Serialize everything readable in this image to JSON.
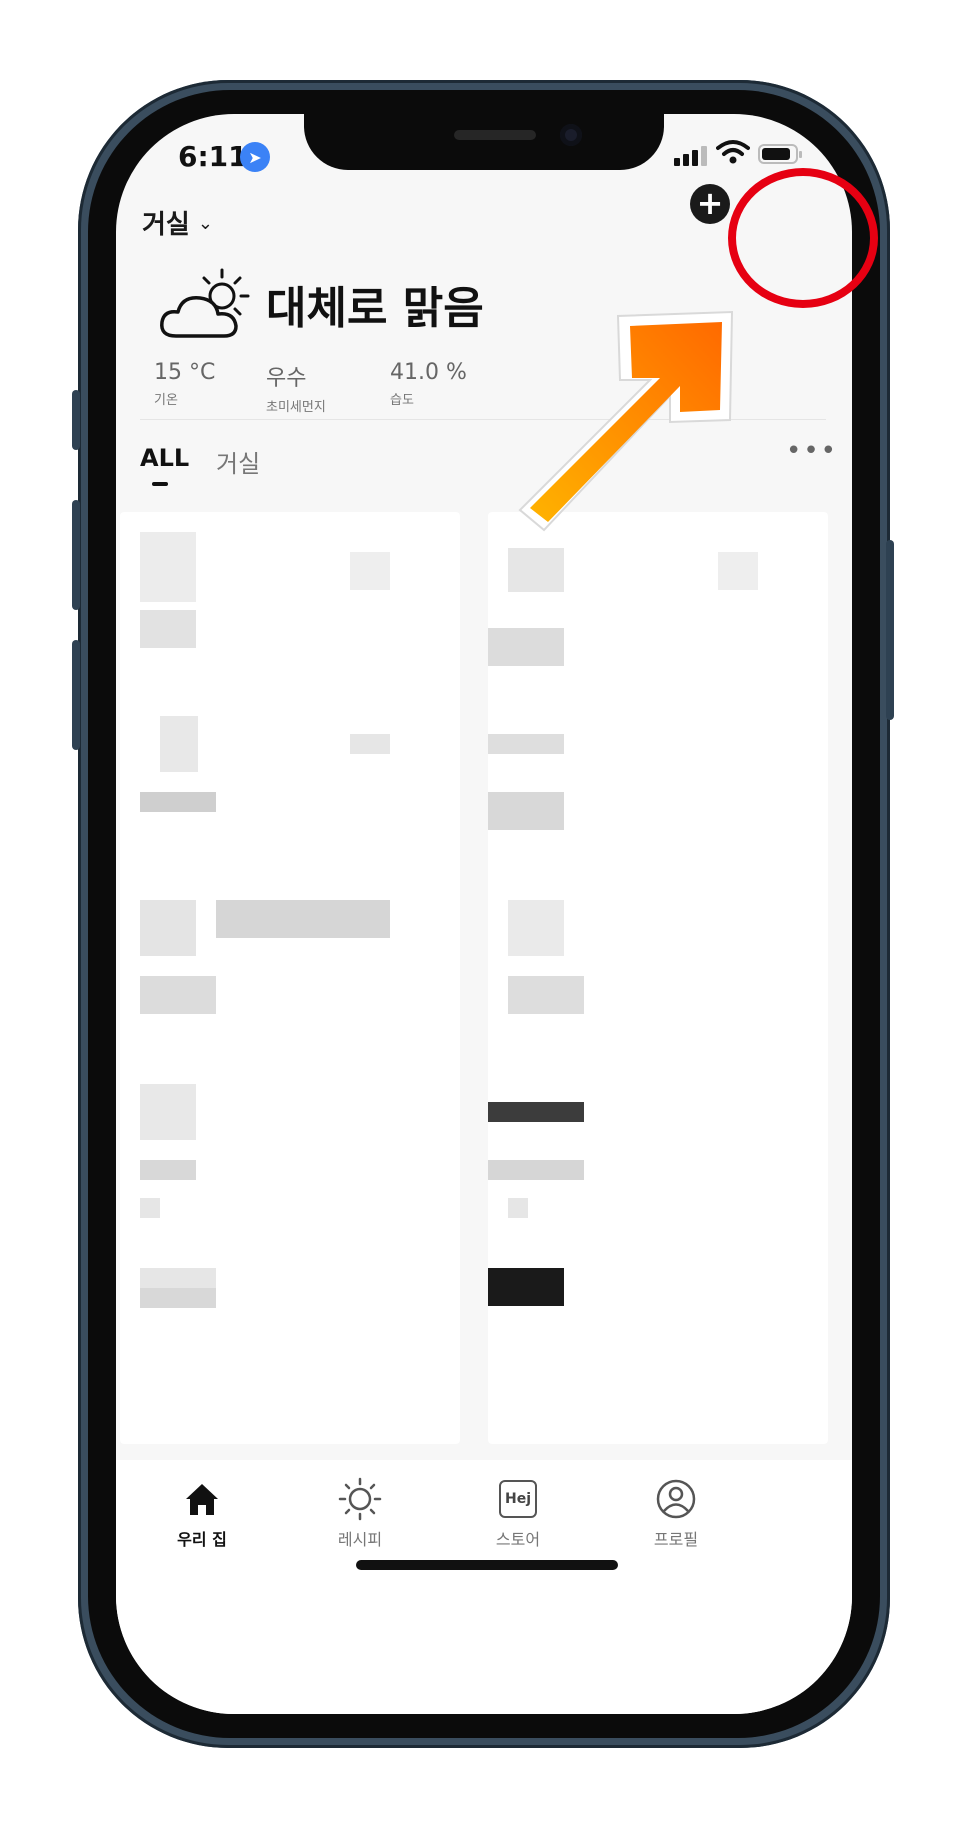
{
  "status_bar": {
    "time": "6:11"
  },
  "header": {
    "room": "거실"
  },
  "weather": {
    "condition": "대체로 맑음",
    "stats": [
      {
        "value": "15 °C",
        "label": "기온"
      },
      {
        "value": "우수",
        "label": "초미세먼지"
      },
      {
        "value": "41.0 %",
        "label": "습도"
      }
    ]
  },
  "tabs": [
    {
      "label": "ALL"
    },
    {
      "label": "거실"
    }
  ],
  "bottom_nav": [
    {
      "label": "우리 집",
      "icon": "home-icon"
    },
    {
      "label": "레시피",
      "icon": "sun-icon"
    },
    {
      "label": "스토어",
      "icon": "hej-store-icon"
    },
    {
      "label": "프로필",
      "icon": "profile-icon"
    }
  ],
  "store_icon_text": "Hej",
  "colors": {
    "highlight": "#e60012",
    "arrow": "#ff7a00",
    "location": "#3b82f6"
  }
}
